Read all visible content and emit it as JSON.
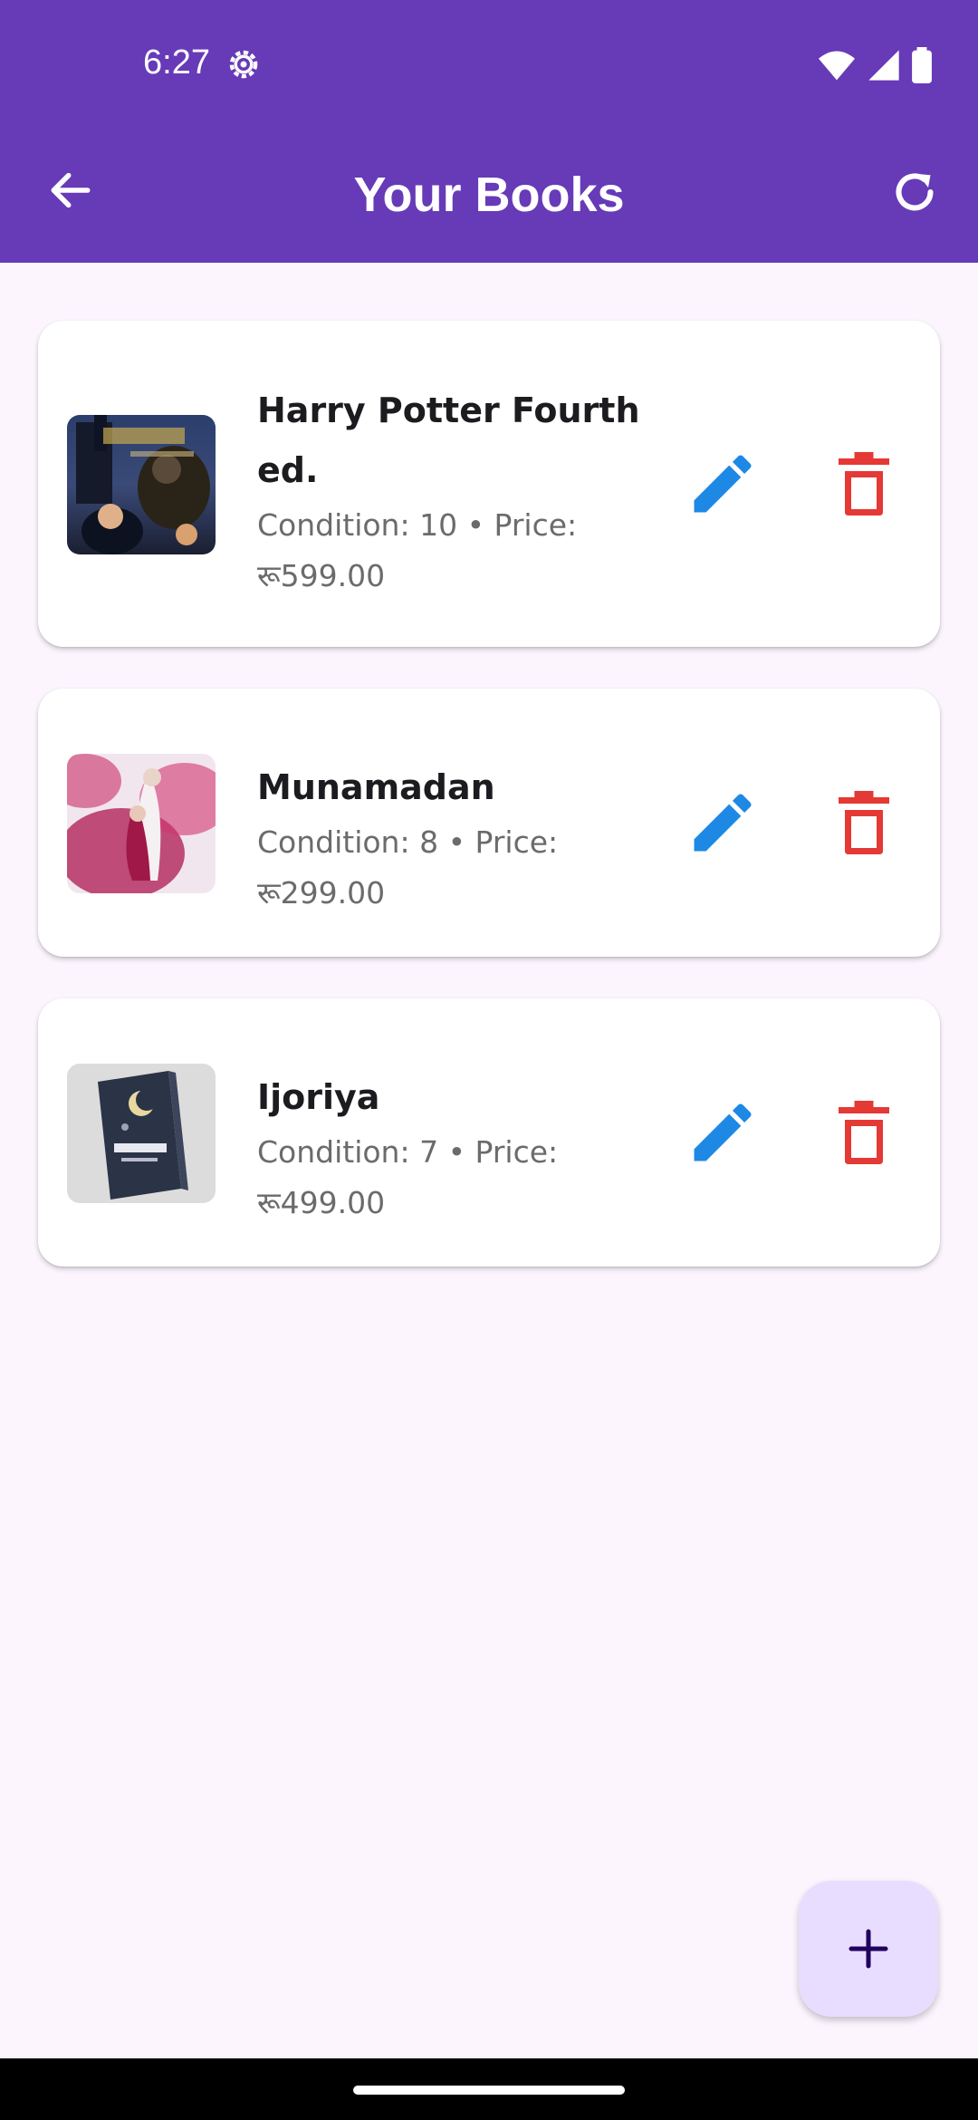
{
  "status_bar": {
    "time": "6:27"
  },
  "app_bar": {
    "title": "Your Books"
  },
  "books": [
    {
      "title": "Harry Potter Fourth ed.",
      "meta": "Condition: 10 • Price: रू599.00"
    },
    {
      "title": "Munamadan",
      "meta": "Condition: 8 • Price: रू299.00"
    },
    {
      "title": "Ijoriya",
      "meta": "Condition: 7 • Price: रू499.00"
    }
  ],
  "colors": {
    "primary": "#673AB7",
    "edit": "#1E88E5",
    "delete": "#E53935",
    "fab": "#E9DDFF"
  }
}
